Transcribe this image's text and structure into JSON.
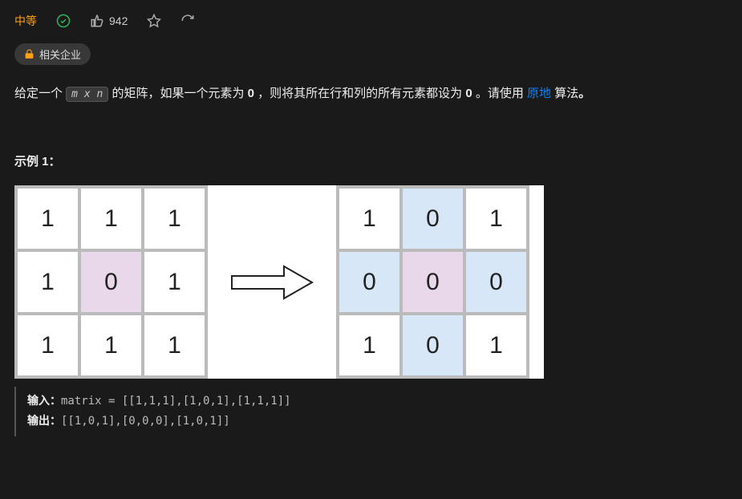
{
  "header": {
    "difficulty": "中等",
    "likes": "942"
  },
  "tags": {
    "companies": "相关企业"
  },
  "description": {
    "part1": "给定一个 ",
    "code": "m x n",
    "part2": " 的矩阵，如果一个元素为 ",
    "bold1": "0",
    "part3": " ，则将其所在行和列的所有元素都设为 ",
    "bold2": "0",
    "part4": " 。请使用 ",
    "link": "原地",
    "part5": " 算法",
    "bold3": "。"
  },
  "example1": {
    "heading": "示例 1：",
    "input_label": "输入：",
    "input_value": "matrix = [[1,1,1],[1,0,1],[1,1,1]]",
    "output_label": "输出：",
    "output_value": "[[1,0,1],[0,0,0],[1,0,1]]",
    "matrix_in": [
      [
        {
          "v": "1",
          "c": ""
        },
        {
          "v": "1",
          "c": ""
        },
        {
          "v": "1",
          "c": ""
        }
      ],
      [
        {
          "v": "1",
          "c": ""
        },
        {
          "v": "0",
          "c": "purple"
        },
        {
          "v": "1",
          "c": ""
        }
      ],
      [
        {
          "v": "1",
          "c": ""
        },
        {
          "v": "1",
          "c": ""
        },
        {
          "v": "1",
          "c": ""
        }
      ]
    ],
    "matrix_out": [
      [
        {
          "v": "1",
          "c": ""
        },
        {
          "v": "0",
          "c": "blue"
        },
        {
          "v": "1",
          "c": ""
        }
      ],
      [
        {
          "v": "0",
          "c": "blue"
        },
        {
          "v": "0",
          "c": "purple"
        },
        {
          "v": "0",
          "c": "blue"
        }
      ],
      [
        {
          "v": "1",
          "c": ""
        },
        {
          "v": "0",
          "c": "blue"
        },
        {
          "v": "1",
          "c": ""
        }
      ]
    ]
  }
}
